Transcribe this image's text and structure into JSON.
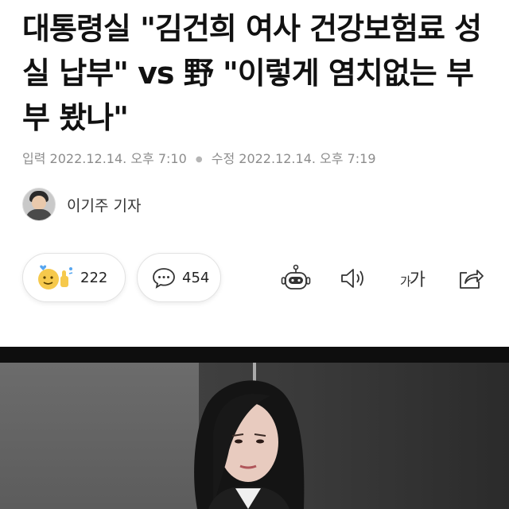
{
  "article": {
    "headline": "대통령실 \"김건희 여사 건강보험료 성실 납부\" vs 野 \"이렇게 염치없는 부부 봤나\"",
    "published_label": "입력",
    "published_time": "2022.12.14. 오후 7:10",
    "modified_label": "수정",
    "modified_time": "2022.12.14. 오후 7:19",
    "reporter": "이기주 기자"
  },
  "actions": {
    "reactions_count": "222",
    "comments_count": "454"
  },
  "toolbar": {
    "font_size_label_small": "가",
    "font_size_label_large": "가",
    "icons": [
      "robot-summary-icon",
      "speaker-icon",
      "font-size-icon",
      "share-icon"
    ]
  },
  "colors": {
    "meta_text": "#8c8c8c",
    "reaction_yellow": "#f6c94c",
    "reaction_blue": "#57a6f0"
  }
}
